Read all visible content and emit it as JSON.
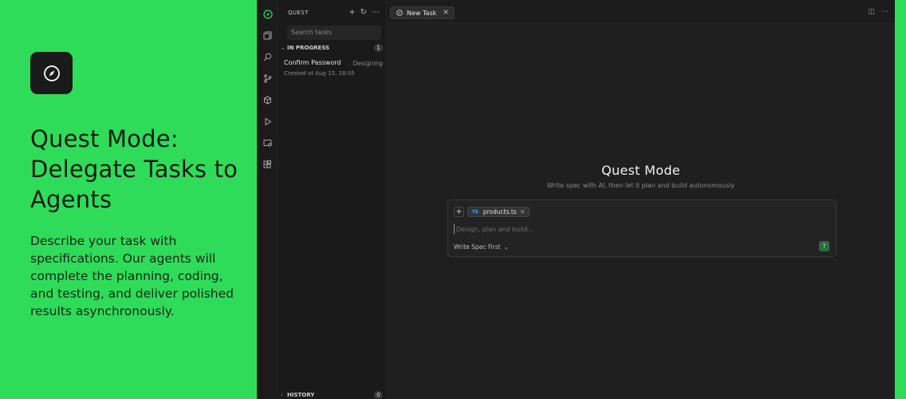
{
  "hero": {
    "title": "Quest Mode: Delegate Tasks to Agents",
    "description": "Describe your task with specifications. Our agents will complete the planning, coding, and testing, and deliver polished results asynchronously."
  },
  "activity_bar": {
    "icons": [
      "quest-icon",
      "files-icon",
      "search-icon",
      "source-control-icon",
      "extensions-icon",
      "run-debug-icon",
      "remote-icon",
      "apps-icon"
    ]
  },
  "sidebar": {
    "header": "QUEST",
    "search_placeholder": "Search tasks",
    "in_progress": {
      "label": "IN PROGRESS",
      "count": "1"
    },
    "task": {
      "title": "Confirm Password",
      "status": "Designing",
      "created": "Created at Aug 15, 18:05"
    },
    "history": {
      "label": "HISTORY",
      "count": "0"
    }
  },
  "editor": {
    "tab_label": "New Task",
    "title": "Quest Mode",
    "subtitle": "Write spec with AI, then let it plan and build autonomously",
    "composer": {
      "attachment": "products.ts",
      "attachment_type": "TS",
      "placeholder": "Design, plan and build...",
      "mode": "Write Spec First"
    }
  },
  "colors": {
    "accent": "#2fdc5a",
    "panel": "#1e1e1e"
  }
}
